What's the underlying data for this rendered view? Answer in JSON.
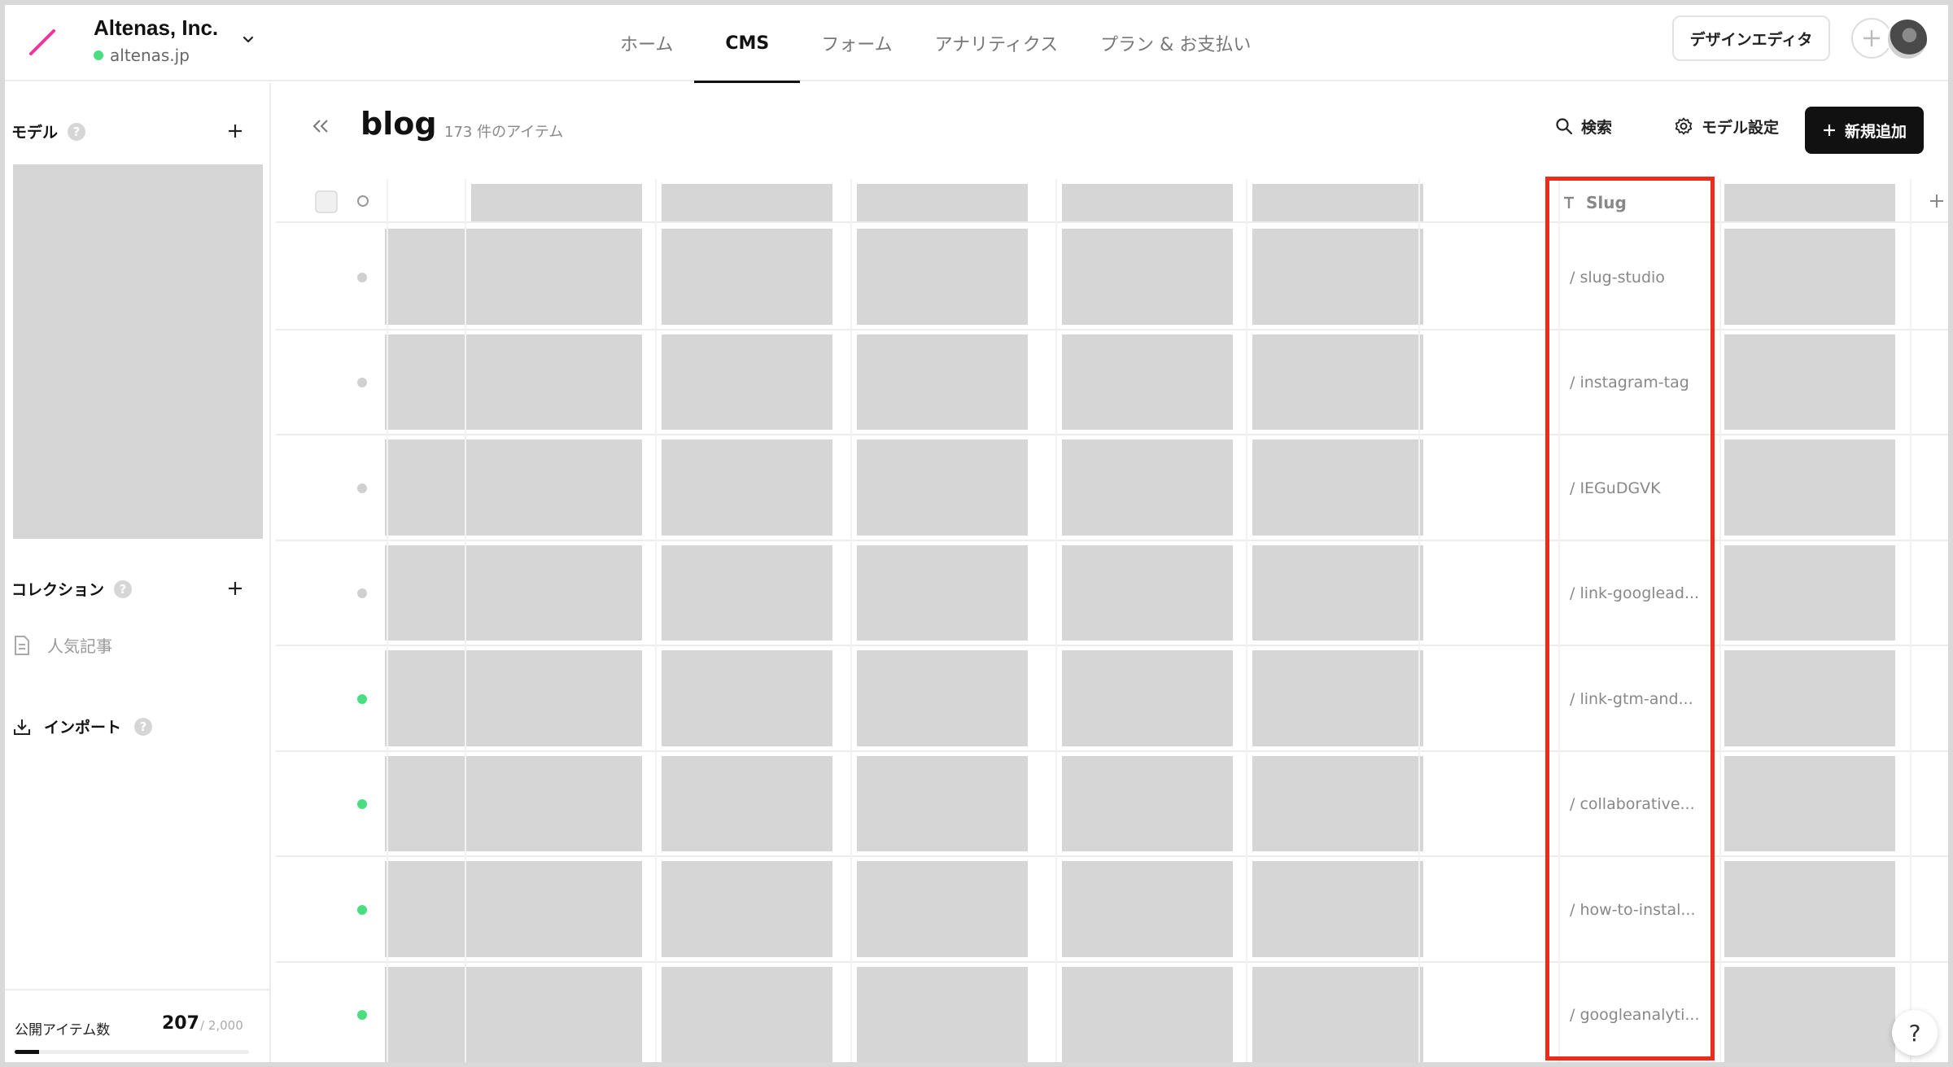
{
  "header": {
    "org_name": "Altenas, Inc.",
    "org_domain": "altenas.jp",
    "nav_tabs": [
      {
        "label": "ホーム",
        "active": false
      },
      {
        "label": "CMS",
        "active": true
      },
      {
        "label": "フォーム",
        "active": false
      },
      {
        "label": "アナリティクス",
        "active": false
      },
      {
        "label": "プラン & お支払い",
        "active": false
      }
    ],
    "design_editor_label": "デザインエディタ"
  },
  "sidebar": {
    "models_label": "モデル",
    "collections_label": "コレクション",
    "collection_items": [
      "人気記事"
    ],
    "import_label": "インポート",
    "published_label": "公開アイテム数",
    "published_count": "207",
    "published_limit": "/ 2,000",
    "published_fraction": 0.1035
  },
  "main": {
    "model_title": "blog",
    "item_count": "173 件のアイテム",
    "search_label": "検索",
    "model_settings_label": "モデル設定",
    "add_new_label": "新規追加",
    "slug_column_label": "Slug",
    "rows": [
      {
        "slug": "/ slug-studio",
        "published": false
      },
      {
        "slug": "/ instagram-tag",
        "published": false
      },
      {
        "slug": "/ IEGuDGVK",
        "published": false
      },
      {
        "slug": "/ link-googlead...",
        "published": false
      },
      {
        "slug": "/ link-gtm-and...",
        "published": true
      },
      {
        "slug": "/ collaborative...",
        "published": true
      },
      {
        "slug": "/ how-to-instal...",
        "published": true
      },
      {
        "slug": "/ googleanalyti...",
        "published": true
      }
    ]
  },
  "colors": {
    "published_dot": "#4ade80",
    "unpublished_dot": "#d0d0d0",
    "highlight": "#ee2a1b",
    "logo": "#f0349a"
  },
  "help_fab_label": "?"
}
